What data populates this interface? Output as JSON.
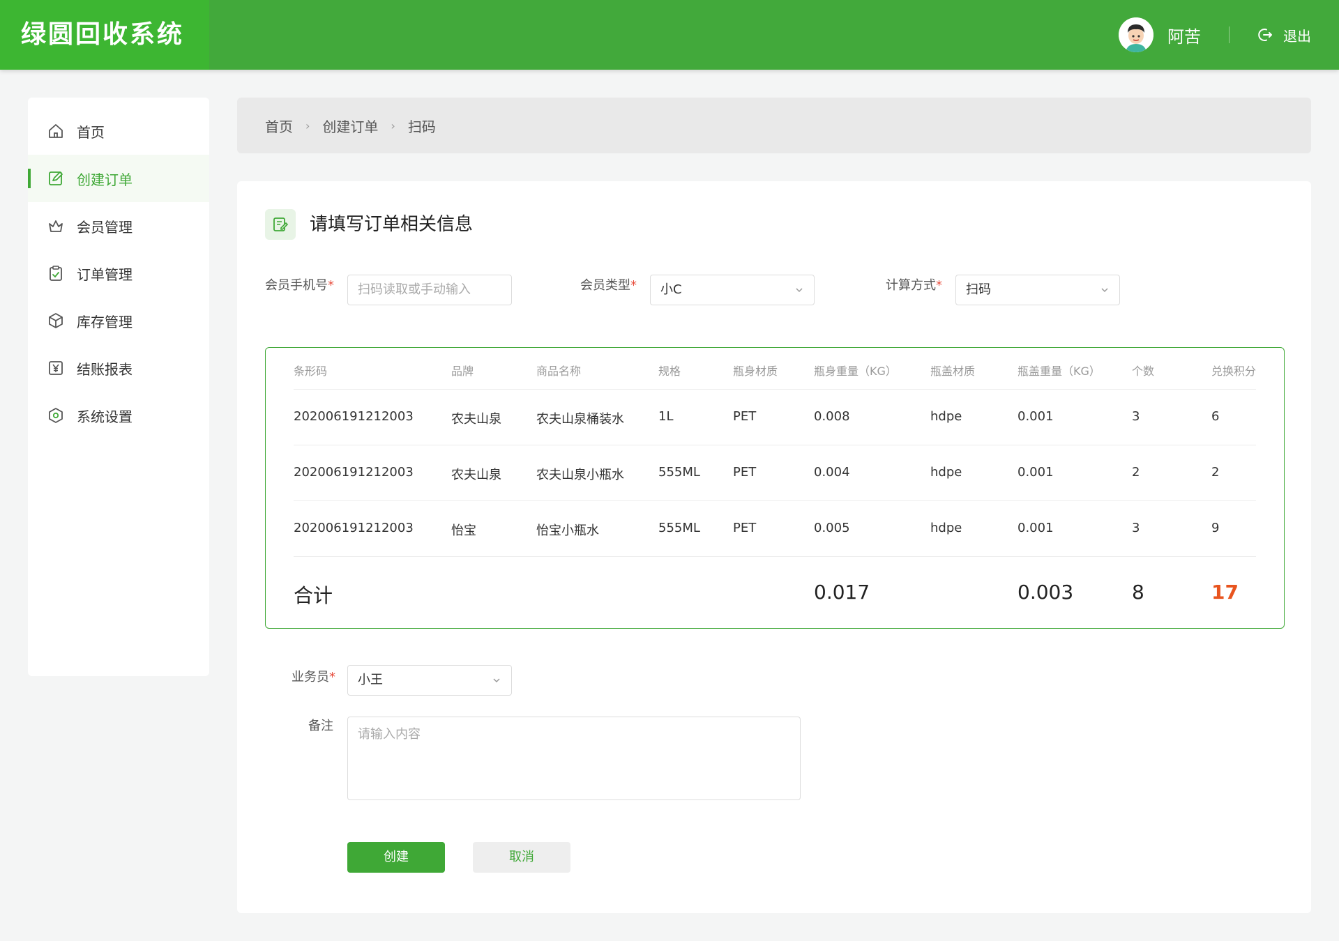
{
  "app": {
    "title": "绿圆回收系统"
  },
  "user": {
    "name": "阿苦",
    "logout_label": "退出"
  },
  "sidebar": {
    "items": [
      {
        "label": "首页",
        "icon": "home-icon",
        "active": false
      },
      {
        "label": "创建订单",
        "icon": "edit-order-icon",
        "active": true
      },
      {
        "label": "会员管理",
        "icon": "crown-icon",
        "active": false
      },
      {
        "label": "订单管理",
        "icon": "clipboard-icon",
        "active": false
      },
      {
        "label": "库存管理",
        "icon": "box-icon",
        "active": false
      },
      {
        "label": "结账报表",
        "icon": "yuan-report-icon",
        "active": false
      },
      {
        "label": "系统设置",
        "icon": "settings-icon",
        "active": false
      }
    ]
  },
  "breadcrumb": [
    "首页",
    "创建订单",
    "扫码"
  ],
  "form": {
    "title": "请填写订单相关信息",
    "phone_label": "会员手机号",
    "phone_placeholder": "扫码读取或手动输入",
    "member_type_label": "会员类型",
    "member_type_value": "小C",
    "calc_method_label": "计算方式",
    "calc_method_value": "扫码",
    "salesperson_label": "业务员",
    "salesperson_value": "小王",
    "remark_label": "备注",
    "remark_placeholder": "请输入内容",
    "required_mark": "*",
    "create_label": "创建",
    "cancel_label": "取消"
  },
  "table": {
    "columns": [
      "条形码",
      "品牌",
      "商品名称",
      "规格",
      "瓶身材质",
      "瓶身重量（KG）",
      "瓶盖材质",
      "瓶盖重量（KG）",
      "个数",
      "兑换积分"
    ],
    "rows": [
      [
        "202006191212003",
        "农夫山泉",
        "农夫山泉桶装水",
        "1L",
        "PET",
        "0.008",
        "hdpe",
        "0.001",
        "3",
        "6"
      ],
      [
        "202006191212003",
        "农夫山泉",
        "农夫山泉小瓶水",
        "555ML",
        "PET",
        "0.004",
        "hdpe",
        "0.001",
        "2",
        "2"
      ],
      [
        "202006191212003",
        "怡宝",
        "怡宝小瓶水",
        "555ML",
        "PET",
        "0.005",
        "hdpe",
        "0.001",
        "3",
        "9"
      ]
    ],
    "total": {
      "label": "合计",
      "body_weight": "0.017",
      "cap_weight": "0.003",
      "count": "8",
      "points": "17"
    }
  },
  "colors": {
    "brand_green": "#42a93b",
    "accent_red": "#e8541e"
  }
}
